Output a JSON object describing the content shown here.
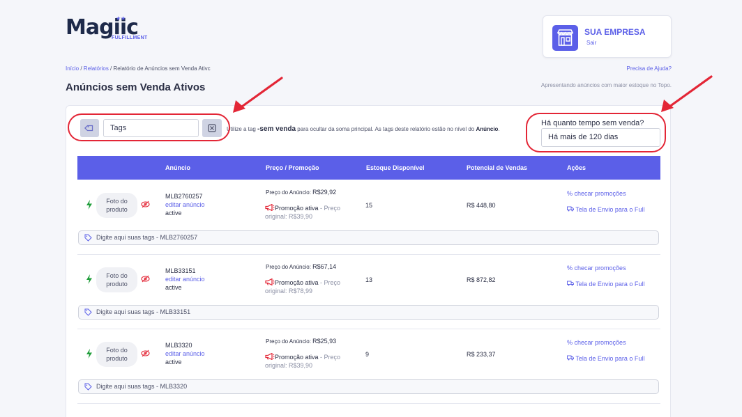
{
  "brand": {
    "logo_text": "Magiic",
    "logo_sub": "FULFILLMENT",
    "logo_stars": "★★"
  },
  "account": {
    "company": "SUA EMPRESA",
    "logout": "Sair"
  },
  "breadcrumb": {
    "home": "Início",
    "sep1": " / ",
    "reports": "Relatórios",
    "sep2": " / ",
    "current": "Relatório de Anúncios sem Venda Ativc"
  },
  "help_link": "Precisa de Ajuda?",
  "page": {
    "title": "Anúncios sem Venda Ativos",
    "subtitle": "Apresentando anúncios com maior estoque no Topo."
  },
  "filters": {
    "tags_placeholder": "Tags",
    "hint_prefix": "Utilize a tag ",
    "hint_tag": "-sem venda",
    "hint_middle": " para ocultar da soma principal. As tags deste relatório estão no nível do ",
    "hint_level": "Anúncio",
    "hint_suffix": ".",
    "time_label": "Há quanto tempo sem venda?",
    "time_value": "Há mais de 120 dias"
  },
  "table": {
    "headers": [
      "Anúncio",
      "Preço / Promoção",
      "Estoque Disponível",
      "Potencial de Vendas",
      "Ações"
    ],
    "rows": [
      {
        "photo": "Foto do produto",
        "code": "MLB2760257",
        "edit": "editar anúncio",
        "status": "active",
        "price_label": "Preço do Anúncio: ",
        "price": "R$29,92",
        "promo": "Promoção ativa",
        "promo_sep": " - ",
        "orig_label": "Preço original: ",
        "orig_price": "R$39,90",
        "stock": "15",
        "potential": "R$ 448,80",
        "action1": "checar promoções",
        "action2": "Tela de Envio para o Full",
        "tags_placeholder": "Digite aqui suas tags - MLB2760257"
      },
      {
        "photo": "Foto do produto",
        "code": "MLB33151",
        "edit": "editar anúncio",
        "status": "active",
        "price_label": "Preço do Anúncio: ",
        "price": "R$67,14",
        "promo": "Promoção ativa",
        "promo_sep": " - ",
        "orig_label": "Preço original: ",
        "orig_price": "R$78,99",
        "stock": "13",
        "potential": "R$ 872,82",
        "action1": "checar promoções",
        "action2": "Tela de Envio para o Full",
        "tags_placeholder": "Digite aqui suas tags - MLB33151"
      },
      {
        "photo": "Foto do produto",
        "code": "MLB3320",
        "edit": "editar anúncio",
        "status": "active",
        "price_label": "Preço do Anúncio: ",
        "price": "R$25,93",
        "promo": "Promoção ativa",
        "promo_sep": " - ",
        "orig_label": "Preço original: ",
        "orig_price": "R$39,90",
        "stock": "9",
        "potential": "R$ 233,37",
        "action1": "checar promoções",
        "action2": "Tela de Envio para o Full",
        "tags_placeholder": "Digite aqui suas tags - MLB3320"
      }
    ]
  },
  "colors": {
    "accent": "#5b5fe8",
    "highlight": "#e32636",
    "bolt": "#1f9d3a",
    "promo_icon": "#e32636"
  },
  "icons": [
    "tag-icon",
    "close-box-icon",
    "store-icon",
    "bolt-icon",
    "eye-off-icon",
    "megaphone-icon",
    "percent-icon",
    "truck-icon"
  ]
}
